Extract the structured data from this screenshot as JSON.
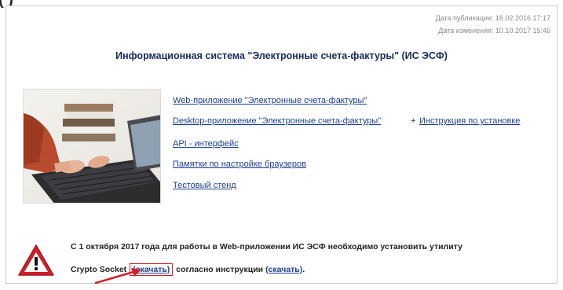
{
  "top_strip_text": "( )",
  "meta": {
    "published": "Дата публикации: 16.02.2016 17:17",
    "modified": "Дата изменения: 10.10.2017 15:46"
  },
  "title": "Информационная система \"Электронные счета-фактуры\" (ИС ЭСФ)",
  "links": {
    "web_app": "Web-приложение \"Электронные счета-фактуры\"",
    "desktop_app": "Desktop-приложение \"Электронные счета-фактуры\"",
    "plus": "+",
    "install_guide": "Инструкция по установке",
    "api": "API - интерфейс",
    "browser_tips": "Памятки по настройке браузеров",
    "test_stand": "Тестовый стенд"
  },
  "notice": {
    "line1": "С 1 октября 2017 года для работы в Web-приложении ИС ЭСФ необходимо установить утилиту",
    "line2_prefix": "Crypto Socket",
    "download_link_1": "(скачать)",
    "line2_middle": "согласно инструкции",
    "download_link_2": "(скачать)",
    "line2_suffix": "."
  },
  "icons": {
    "warning": "warning-icon",
    "arrow": "red-arrow-icon"
  },
  "colors": {
    "link": "#1f3f95",
    "title": "#1b2a5c",
    "highlight_red": "#d0202a",
    "meta_gray": "#8a8a8a"
  }
}
